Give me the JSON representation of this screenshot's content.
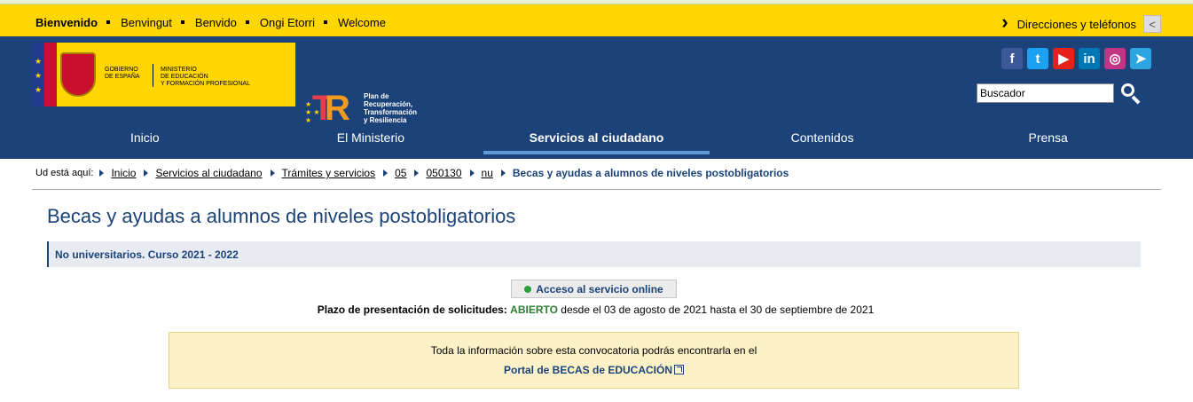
{
  "lang_bar": {
    "languages": [
      "Bienvenido",
      "Benvingut",
      "Benvido",
      "Ongi Etorri",
      "Welcome"
    ],
    "directions_label": "Direcciones y teléfonos"
  },
  "header": {
    "gov_text": "GOBIERNO\nDE ESPAÑA",
    "ministry_text": "MINISTERIO\nDE EDUCACIÓN\nY FORMACIÓN PROFESIONAL",
    "plan_text": "Plan de\nRecuperación,\nTransformación\ny Resiliencia",
    "social": [
      {
        "name": "facebook-icon",
        "glyph": "f",
        "color": "#3b5998"
      },
      {
        "name": "twitter-icon",
        "glyph": "t",
        "color": "#1da1f2"
      },
      {
        "name": "youtube-icon",
        "glyph": "▶",
        "color": "#e62117"
      },
      {
        "name": "linkedin-icon",
        "glyph": "in",
        "color": "#0077b5"
      },
      {
        "name": "instagram-icon",
        "glyph": "◎",
        "color": "#c13584"
      },
      {
        "name": "telegram-icon",
        "glyph": "➤",
        "color": "#2ca5e0"
      }
    ],
    "search_placeholder": "Buscador"
  },
  "nav": [
    "Inicio",
    "El Ministerio",
    "Servicios al ciudadano",
    "Contenidos",
    "Prensa"
  ],
  "breadcrumb": {
    "label": "Ud está aquí:",
    "links": [
      "Inicio",
      "Servicios al ciudadano",
      "Trámites y servicios",
      "05",
      "050130",
      "nu"
    ],
    "current": "Becas y ayudas a alumnos de niveles postobligatorios"
  },
  "main": {
    "title": "Becas y ayudas a alumnos de niveles postobligatorios",
    "subtitle": "No universitarios. Curso 2021 - 2022",
    "online_button": "Acceso al servicio online",
    "plazo_label": "Plazo de presentación de solicitudes:",
    "plazo_status": "ABIERTO",
    "plazo_dates": "desde el 03 de agosto de 2021 hasta el 30 de septiembre de 2021",
    "notice_text": "Toda la información sobre esta convocatoria podrás encontrarla en el",
    "notice_link": "Portal de BECAS de EDUCACIÓN"
  }
}
